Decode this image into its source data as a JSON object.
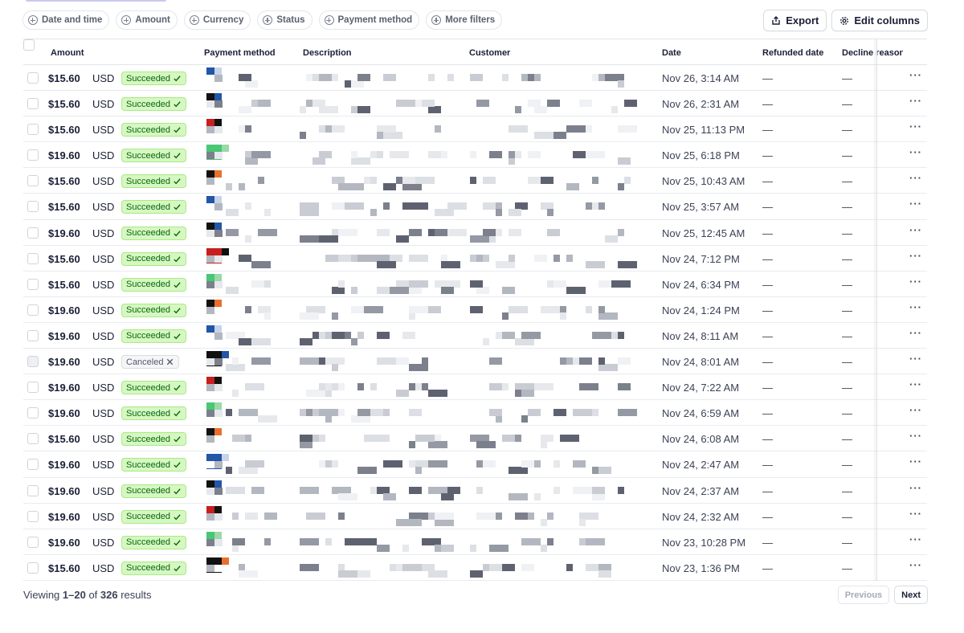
{
  "filters": [
    {
      "label": "Date and time",
      "name": "filter-date-and-time"
    },
    {
      "label": "Amount",
      "name": "filter-amount"
    },
    {
      "label": "Currency",
      "name": "filter-currency"
    },
    {
      "label": "Status",
      "name": "filter-status"
    },
    {
      "label": "Payment method",
      "name": "filter-payment-method"
    },
    {
      "label": "More filters",
      "name": "filter-more"
    }
  ],
  "actions": {
    "export_label": "Export",
    "edit_columns_label": "Edit columns"
  },
  "columns": {
    "amount": "Amount",
    "payment_method": "Payment method",
    "description": "Description",
    "customer": "Customer",
    "date": "Date",
    "refunded_date": "Refunded date",
    "decline_reason": "Decline reason"
  },
  "row_actions_label": "···",
  "colors": {
    "success_bg": "#d7f7c2",
    "success_text": "#05690d",
    "brand_blue": "#2156a8"
  },
  "rows": [
    {
      "amount": "$15.60",
      "currency": "USD",
      "status": "Succeeded",
      "date": "Nov 26, 3:14 AM",
      "refunded": "—",
      "decline": "—"
    },
    {
      "amount": "$15.60",
      "currency": "USD",
      "status": "Succeeded",
      "date": "Nov 26, 2:31 AM",
      "refunded": "—",
      "decline": "—"
    },
    {
      "amount": "$15.60",
      "currency": "USD",
      "status": "Succeeded",
      "date": "Nov 25, 11:13 PM",
      "refunded": "—",
      "decline": "—"
    },
    {
      "amount": "$19.60",
      "currency": "USD",
      "status": "Succeeded",
      "date": "Nov 25, 6:18 PM",
      "refunded": "—",
      "decline": "—"
    },
    {
      "amount": "$15.60",
      "currency": "USD",
      "status": "Succeeded",
      "date": "Nov 25, 10:43 AM",
      "refunded": "—",
      "decline": "—"
    },
    {
      "amount": "$15.60",
      "currency": "USD",
      "status": "Succeeded",
      "date": "Nov 25, 3:57 AM",
      "refunded": "—",
      "decline": "—"
    },
    {
      "amount": "$19.60",
      "currency": "USD",
      "status": "Succeeded",
      "date": "Nov 25, 12:45 AM",
      "refunded": "—",
      "decline": "—"
    },
    {
      "amount": "$15.60",
      "currency": "USD",
      "status": "Succeeded",
      "date": "Nov 24, 7:12 PM",
      "refunded": "—",
      "decline": "—"
    },
    {
      "amount": "$15.60",
      "currency": "USD",
      "status": "Succeeded",
      "date": "Nov 24, 6:34 PM",
      "refunded": "—",
      "decline": "—"
    },
    {
      "amount": "$19.60",
      "currency": "USD",
      "status": "Succeeded",
      "date": "Nov 24, 1:24 PM",
      "refunded": "—",
      "decline": "—"
    },
    {
      "amount": "$19.60",
      "currency": "USD",
      "status": "Succeeded",
      "date": "Nov 24, 8:11 AM",
      "refunded": "—",
      "decline": "—"
    },
    {
      "amount": "$19.60",
      "currency": "USD",
      "status": "Canceled",
      "date": "Nov 24, 8:01 AM",
      "refunded": "—",
      "decline": "—"
    },
    {
      "amount": "$19.60",
      "currency": "USD",
      "status": "Succeeded",
      "date": "Nov 24, 7:22 AM",
      "refunded": "—",
      "decline": "—"
    },
    {
      "amount": "$19.60",
      "currency": "USD",
      "status": "Succeeded",
      "date": "Nov 24, 6:59 AM",
      "refunded": "—",
      "decline": "—"
    },
    {
      "amount": "$15.60",
      "currency": "USD",
      "status": "Succeeded",
      "date": "Nov 24, 6:08 AM",
      "refunded": "—",
      "decline": "—"
    },
    {
      "amount": "$19.60",
      "currency": "USD",
      "status": "Succeeded",
      "date": "Nov 24, 2:47 AM",
      "refunded": "—",
      "decline": "—"
    },
    {
      "amount": "$19.60",
      "currency": "USD",
      "status": "Succeeded",
      "date": "Nov 24, 2:37 AM",
      "refunded": "—",
      "decline": "—"
    },
    {
      "amount": "$19.60",
      "currency": "USD",
      "status": "Succeeded",
      "date": "Nov 24, 2:32 AM",
      "refunded": "—",
      "decline": "—"
    },
    {
      "amount": "$19.60",
      "currency": "USD",
      "status": "Succeeded",
      "date": "Nov 23, 10:28 PM",
      "refunded": "—",
      "decline": "—"
    },
    {
      "amount": "$15.60",
      "currency": "USD",
      "status": "Succeeded",
      "date": "Nov 23, 1:36 PM",
      "refunded": "—",
      "decline": "—"
    }
  ],
  "footer": {
    "viewing_prefix": "Viewing ",
    "range": "1–20",
    "of_text": " of ",
    "total": "326",
    "results_text": " results"
  },
  "pagination": {
    "previous": "Previous",
    "next": "Next"
  }
}
